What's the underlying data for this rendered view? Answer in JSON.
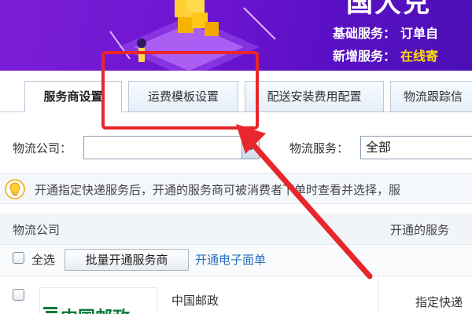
{
  "banner": {
    "big_text": "国大兑",
    "line1_label": "基础服务：",
    "line1_value": "订单自",
    "line2_label": "新增服务：",
    "line2_value": "在线寄"
  },
  "tabs": [
    {
      "label": "服务商设置",
      "active": true
    },
    {
      "label": "运费模板设置",
      "active": false
    },
    {
      "label": "配送安装费用配置",
      "active": false
    },
    {
      "label": "物流跟踪信",
      "active": false
    }
  ],
  "filters": {
    "company_label": "物流公司：",
    "company_value": "",
    "service_label": "物流服务：",
    "service_value": "全部"
  },
  "info": {
    "text": "开通指定快递服务后，开通的服务商可被消费者下单时查看并选择，服"
  },
  "table": {
    "col_company": "物流公司",
    "col_service": "开通的服务",
    "select_all": "全选",
    "batch_button": "批量开通服务商",
    "link_text": "开通电子面单",
    "rows": [
      {
        "name": "中国邮政",
        "logo_text": "中国邮政",
        "service": "指定快递"
      }
    ]
  },
  "colors": {
    "banner_bg": "#6d14d0",
    "highlight_yellow": "#ffe100",
    "annotation_red": "#e8262b",
    "link_blue": "#2a6fbf"
  }
}
